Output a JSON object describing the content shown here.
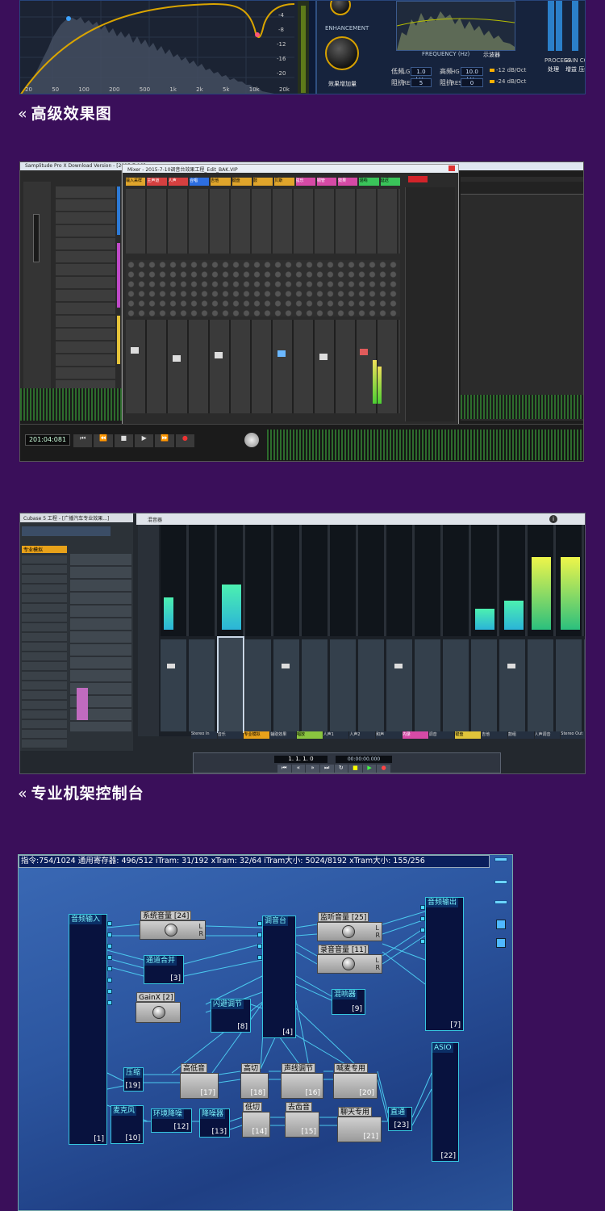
{
  "shot1": {
    "eq_db_labels": [
      "-4",
      "-8",
      "-12",
      "-16",
      "-20"
    ],
    "eq_freq_labels": [
      "20",
      "50",
      "100",
      "200",
      "500",
      "1k",
      "2k",
      "5k",
      "10k",
      "20k"
    ],
    "enh_mid_label": "ENHANCEMENT",
    "enh_bottom_label": "效果增加量",
    "enh_freq_label": "FREQUENCY (Hz)",
    "enh_freq_label_cn": "示波器",
    "low_label": "低频",
    "low_lg": "LG",
    "low_freq": "1.0 kHz",
    "low_amt_label": "阻抗",
    "low_res": "RES",
    "low_val": "5",
    "high_label": "高频",
    "high_hg": "HG",
    "high_freq": "10.0 kHz",
    "high_amt_label": "阻抗",
    "high_res": "RES",
    "high_val": "0",
    "led1": "-12 dB/Oct",
    "led2": "-24 dB/Oct",
    "process_label": "PROCESS",
    "process_cn": "处理",
    "gain_label": "GAIN COMP",
    "gain_cn": "增益 压缩"
  },
  "caption1": "高级效果图",
  "shot2": {
    "title_left": "Samplitude Pro X Download Version - [2015-7-10]",
    "title_right": "Mixer - 2015-7-10调音台效果工程_Edit_BAK.VIP",
    "transport_time": "201:04:081",
    "channel_labels": [
      "输入采样",
      "主声道",
      "人声",
      "合唱",
      "吉他",
      "键盘",
      "鼓",
      "贝斯",
      "弦乐",
      "铜管",
      "效果",
      "混响",
      "延迟"
    ]
  },
  "caption2": "专业机架控制台",
  "shot3": {
    "title_left": "Cubase 5 工程 - [广播汽车专业效果...]",
    "title_right": "混音器",
    "inspector_label": "专业模拟",
    "bottom_channel_labels": [
      "Stereo In",
      "音乐",
      "专业模拟",
      "辅助效果",
      "唱放",
      "人声1",
      "人声2",
      "和声",
      "内录",
      "调音",
      "键盘",
      "吉他",
      "鼓组",
      "人声调音",
      "Stereo Out"
    ],
    "transport_position": "1. 1. 1. 0",
    "transport_time": "00:00:00.000"
  },
  "shot4": {
    "status_bar": "指令:754/1024 通用寄存器: 496/512 iTram: 31/192 xTram: 32/64 iTram大小: 5024/8192 xTram大小: 155/256",
    "modules": {
      "m1": {
        "name": "音频输入",
        "id": "[1]"
      },
      "m3": {
        "name": "通道合并",
        "id": "[3]"
      },
      "m4": {
        "name": "调音台",
        "id": "[4]"
      },
      "m7": {
        "name": "音频输出",
        "id": "[7]"
      },
      "m8": {
        "name": "闪避调节",
        "id": "[8]"
      },
      "m9": {
        "name": "混响器",
        "id": "[9]"
      },
      "m10": {
        "name": "麦克风",
        "id": "[10]"
      },
      "m12": {
        "name": "环境降噪",
        "id": "[12]"
      },
      "m13": {
        "name": "降噪器",
        "id": "[13]"
      },
      "m14": {
        "name": "低切",
        "id": "[14]"
      },
      "m15": {
        "name": "去齿音",
        "id": "[15]"
      },
      "m16": {
        "name": "声线调节",
        "id": "[16]"
      },
      "m17": {
        "name": "高低音",
        "id": "[17]"
      },
      "m18": {
        "name": "高切",
        "id": "[18]"
      },
      "m19": {
        "name": "压缩",
        "id": "[19]"
      },
      "m20": {
        "name": "喊麦专用",
        "id": "[20]"
      },
      "m21": {
        "name": "聊天专用",
        "id": "[21]"
      },
      "m22": {
        "name": "ASIO",
        "id": "[22]"
      },
      "m23": {
        "name": "直通",
        "id": "[23]"
      },
      "g24": {
        "name": "系统音量 [24]"
      },
      "g25": {
        "name": "监听音量 [25]"
      },
      "g11": {
        "name": "录音音量 [11]"
      },
      "g2": {
        "name": "GainX [2]"
      }
    },
    "lr_label": "L\nR"
  },
  "colors": {
    "background": "#3a0f5a",
    "module_border": "#36c7e0",
    "wire": "#4bc9ee"
  }
}
